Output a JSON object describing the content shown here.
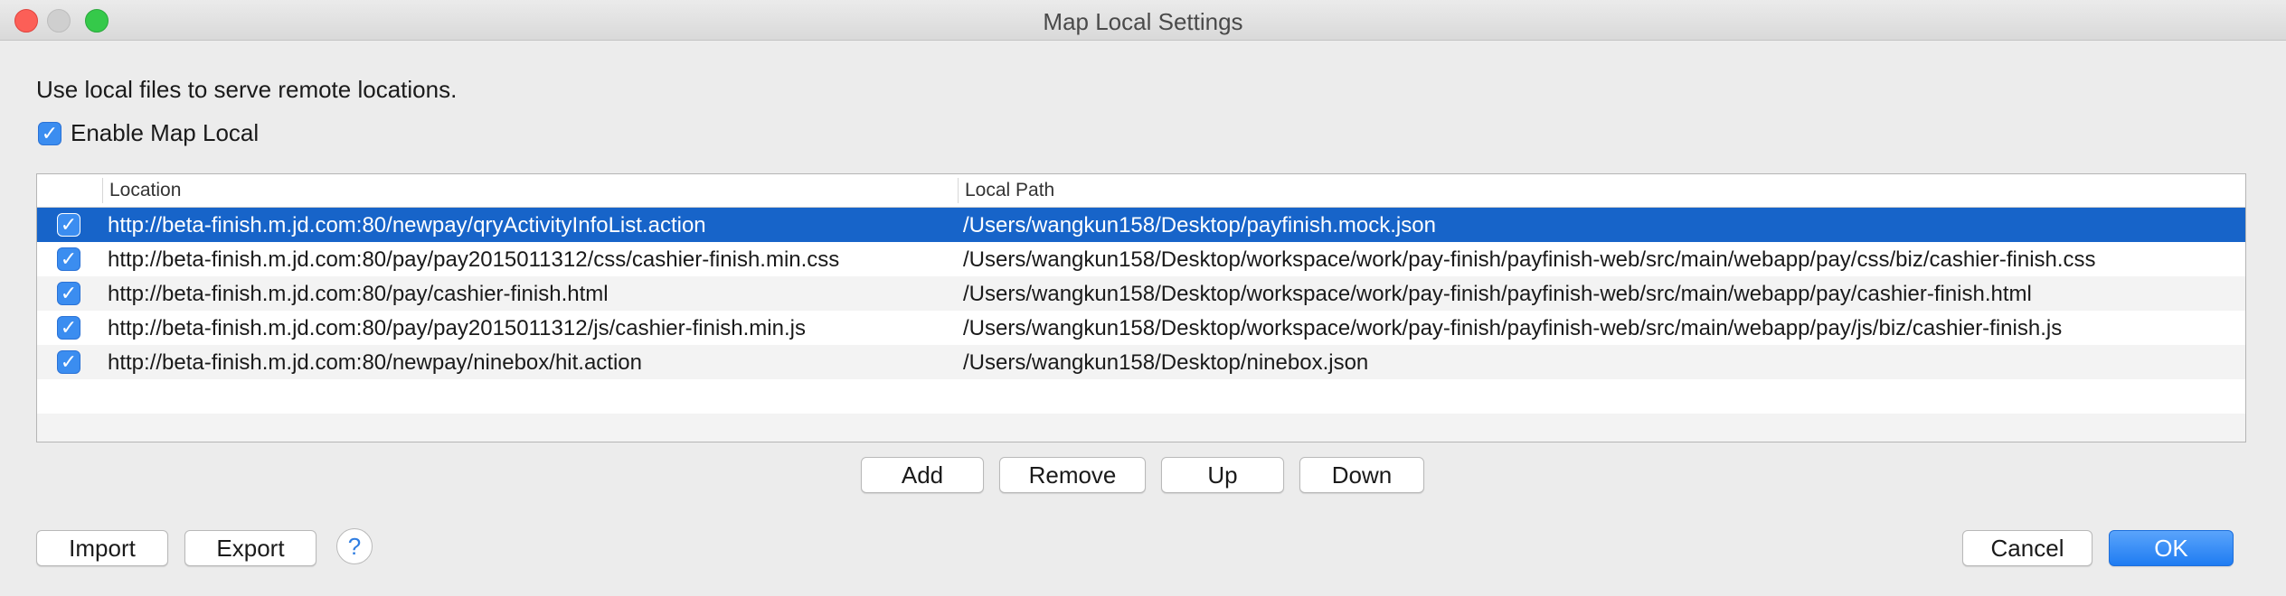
{
  "window": {
    "title": "Map Local Settings"
  },
  "intro_text": "Use local files to serve remote locations.",
  "enable": {
    "label": "Enable Map Local",
    "checked": true
  },
  "table": {
    "columns": {
      "location": "Location",
      "local_path": "Local Path"
    },
    "rows": [
      {
        "checked": true,
        "location": "http://beta-finish.m.jd.com:80/newpay/qryActivityInfoList.action",
        "path": "/Users/wangkun158/Desktop/payfinish.mock.json",
        "selected": true
      },
      {
        "checked": true,
        "location": "http://beta-finish.m.jd.com:80/pay/pay2015011312/css/cashier-finish.min.css",
        "path": "/Users/wangkun158/Desktop/workspace/work/pay-finish/payfinish-web/src/main/webapp/pay/css/biz/cashier-finish.css",
        "selected": false
      },
      {
        "checked": true,
        "location": "http://beta-finish.m.jd.com:80/pay/cashier-finish.html",
        "path": "/Users/wangkun158/Desktop/workspace/work/pay-finish/payfinish-web/src/main/webapp/pay/cashier-finish.html",
        "selected": false
      },
      {
        "checked": true,
        "location": "http://beta-finish.m.jd.com:80/pay/pay2015011312/js/cashier-finish.min.js",
        "path": "/Users/wangkun158/Desktop/workspace/work/pay-finish/payfinish-web/src/main/webapp/pay/js/biz/cashier-finish.js",
        "selected": false
      },
      {
        "checked": true,
        "location": "http://beta-finish.m.jd.com:80/newpay/ninebox/hit.action",
        "path": "/Users/wangkun158/Desktop/ninebox.json",
        "selected": false
      }
    ]
  },
  "table_buttons": {
    "add": "Add",
    "remove": "Remove",
    "up": "Up",
    "down": "Down"
  },
  "footer": {
    "import": "Import",
    "export": "Export",
    "help": "?",
    "cancel": "Cancel",
    "ok": "OK"
  },
  "icons": {
    "checkbox": "checkmark-icon",
    "help": "question-icon"
  },
  "colors": {
    "accent": "#1764c9",
    "checkbox": "#3b8df0",
    "close": "#fc5f57",
    "maximize": "#35c94a"
  }
}
